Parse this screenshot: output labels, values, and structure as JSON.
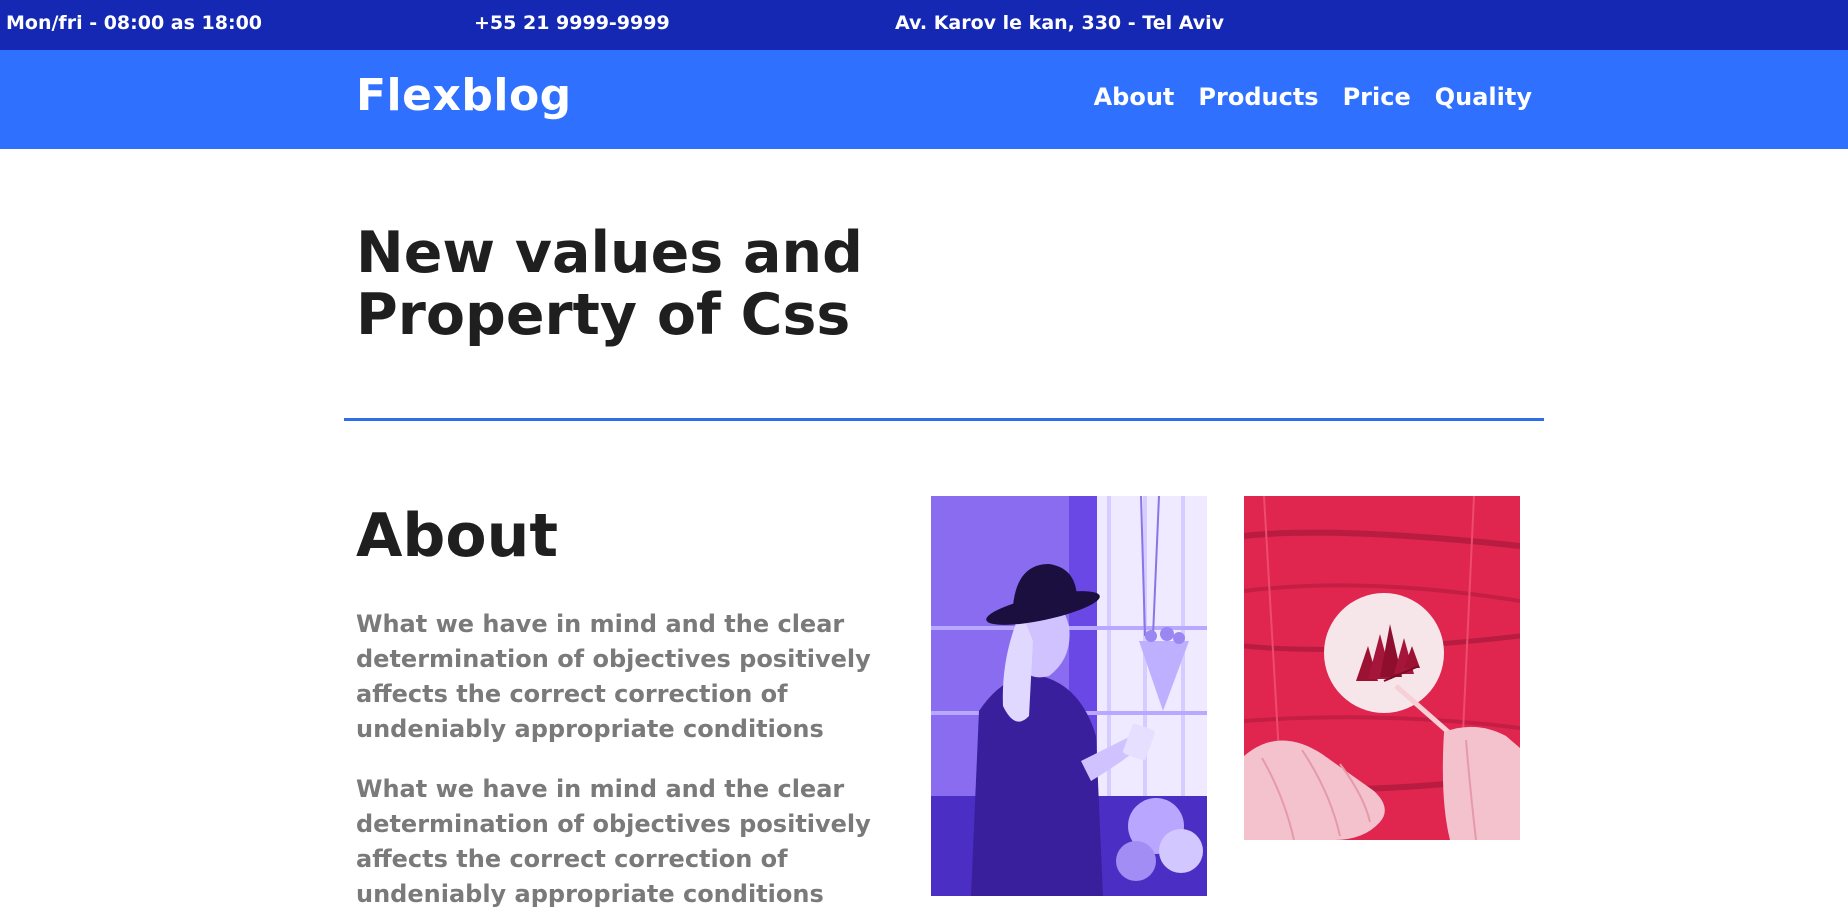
{
  "topbar": {
    "hours": "Mon/fri - 08:00 as 18:00",
    "phone": "+55 21 9999-9999",
    "address": "Av. Karov le kan, 330 - Tel Aviv"
  },
  "header": {
    "logo": "Flexblog",
    "nav": [
      "About",
      "Products",
      "Price",
      "Quality"
    ]
  },
  "hero": {
    "title_line1": "New values and",
    "title_line2": "Property of Css"
  },
  "about": {
    "title": "About",
    "paragraphs": [
      "What we have in mind and the clear determination of objectives positively affects the correct correction of undeniably appropriate conditions",
      "What we have in mind and the clear determination of objectives positively affects the correct correction of undeniably appropriate conditions"
    ]
  },
  "colors": {
    "topbar": "#1428b4",
    "navbar": "#2f70ff",
    "divider": "#2f6ee6",
    "photo_purple": "#6f4fe8",
    "photo_pink": "#e0264f"
  }
}
